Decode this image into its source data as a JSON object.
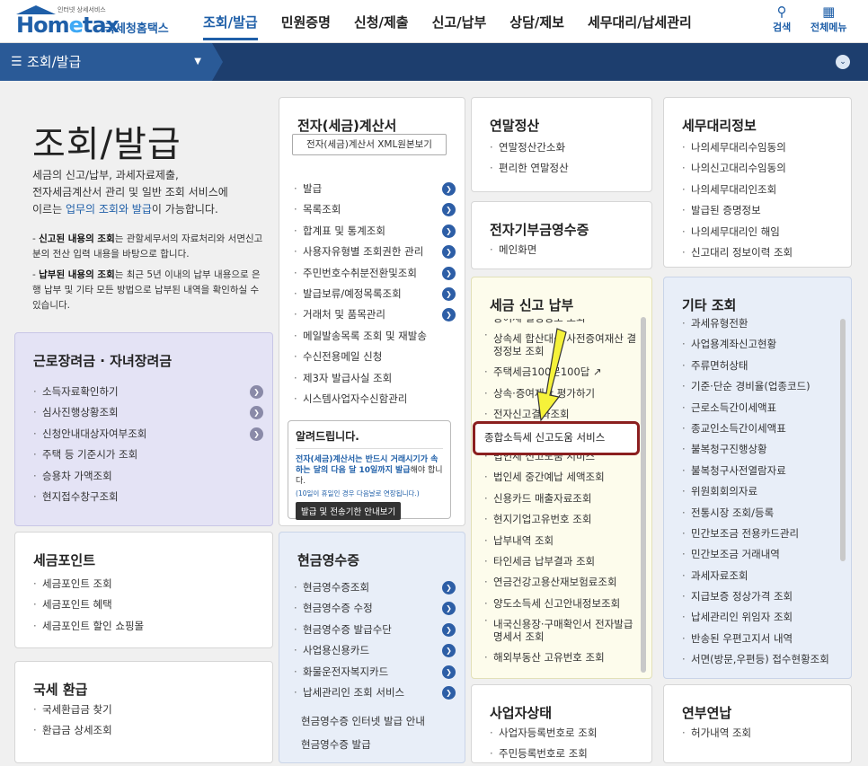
{
  "header": {
    "logo_small": "인터넷 상세서비스",
    "logo_main": "Hometax",
    "logo_kr": "국세청홈택스",
    "menu": [
      "조회/발급",
      "민원증명",
      "신청/제출",
      "신고/납부",
      "상담/제보",
      "세무대리/납세관리"
    ],
    "search_label": "검색",
    "all_menu_label": "전체메뉴"
  },
  "navbar": {
    "current": "조회/발급"
  },
  "intro": {
    "title": "조회/발급",
    "desc1": "세금의 신고/납부, 과세자료제출,",
    "desc2": "전자세금계산서 관리 및 일반 조회 서비스에",
    "desc3a": "이르는 ",
    "desc3b": "업무의 조회와 발급",
    "desc3c": "이 가능합니다.",
    "note1_b": "신고된 내용의 조회",
    "note1": "는 관할세무서의 자료처리와 서면신고분의 전산 입력 내용을 바탕으로 합니다.",
    "note2_b": "납부된 내용의 조회",
    "note2": "는 최근 5년 이내의 납부 내용으로 은행 납부 및 기타 모든 방법으로 납부된 내역을 확인하실 수 있습니다."
  },
  "work_incentive": {
    "title": "근로장려금 · 자녀장려금",
    "items": [
      "소득자료확인하기",
      "심사진행상황조회",
      "신청안내대상자여부조회",
      "주택 등 기준시가 조회",
      "승용차 가액조회",
      "현지접수창구조회"
    ]
  },
  "tax_point": {
    "title": "세금포인트",
    "items": [
      "세금포인트 조회",
      "세금포인트 혜택",
      "세금포인트 할인 쇼핑몰"
    ]
  },
  "refund": {
    "title": "국세 환급",
    "items": [
      "국세환급금 찾기",
      "환급금 상세조회"
    ]
  },
  "e_invoice": {
    "title": "전자(세금)계산서",
    "xml_button": "전자(세금)계산서 XML원본보기",
    "items": [
      "발급",
      "목록조회",
      "합계표 및 통계조회",
      "사용자유형별 조회권한 관리",
      "주민번호수취분전환및조회",
      "발급보류/예정목록조회",
      "거래처 및 품목관리",
      "메일발송목록 조회 및 재발송",
      "수신전용메일 신청",
      "제3자 발급사실 조회",
      "시스템사업자수신함관리"
    ]
  },
  "notice": {
    "title": "알려드립니다.",
    "body_b": "전자(세금)계산서는 반드시 거래시기가 속하는 달의 다음 달 10일까지 발급",
    "body": "해야 합니다.",
    "small": "(10일이 휴일인 경우 다음날로 연장됩니다.)",
    "button": "발급 및 전송기한 안내보기"
  },
  "cash_receipt": {
    "title": "현금영수증",
    "items": [
      "현금영수증조회",
      "현금영수증 수정",
      "현금영수증 발급수단",
      "사업용신용카드",
      "화물운전자복지카드",
      "납세관리인 조회 서비스"
    ],
    "extra": [
      "현금영수증 인터넷 발급 안내",
      "현금영수증 발급"
    ]
  },
  "year_end": {
    "title": "연말정산",
    "items": [
      "연말정산간소화",
      "편리한 연말정산"
    ]
  },
  "donation": {
    "title": "전자기부금영수증",
    "items": [
      "메인화면"
    ]
  },
  "tax_report": {
    "title": "세금 신고 납부",
    "items": [
      "증여세 결정정보 조회",
      "상속세 합산대상 사전증여재산 결정정보 조회",
      "주택세금100문100답",
      "상속·증여재산 평가하기",
      "전자신고결과조회",
      "종합소득세 신고도움 서비스",
      "법인세 신고도움 서비스",
      "법인세 중간예납 세액조회",
      "신용카드 매출자료조회",
      "현지기업고유번호 조회",
      "납부내역 조회",
      "타인세금 납부결과 조회",
      "연금건강고용산재보험료조회",
      "양도소득세 신고안내정보조회",
      "내국신용장·구매확인서 전자발급명세서 조회",
      "해외부동산 고유번호 조회"
    ]
  },
  "business": {
    "title": "사업자상태",
    "items": [
      "사업자등록번호로 조회",
      "주민등록번호로 조회"
    ]
  },
  "agent": {
    "title": "세무대리정보",
    "items": [
      "나의세무대리수임동의",
      "나의신고대리수임동의",
      "나의세무대리인조회",
      "발급된 증명정보",
      "나의세무대리인 해임",
      "신고대리 정보이력 조회"
    ]
  },
  "other": {
    "title": "기타 조회",
    "items": [
      "과세유형전환",
      "사업용계좌신고현황",
      "주류면허상태",
      "기준·단순 경비율(업종코드)",
      "근로소득간이세액표",
      "종교인소득간이세액표",
      "불복청구진행상황",
      "불복청구사전열람자료",
      "위원회회의자료",
      "전통시장 조회/등록",
      "민간보조금 전용카드관리",
      "민간보조금 거래내역",
      "과세자료조회",
      "지급보증 정상가격 조회",
      "납세관리인 위임자 조회",
      "반송된 우편고지서 내역",
      "서면(방문,우편등) 접수현황조회"
    ]
  },
  "pension": {
    "title": "연부연납",
    "items": [
      "허가내역 조회"
    ]
  }
}
